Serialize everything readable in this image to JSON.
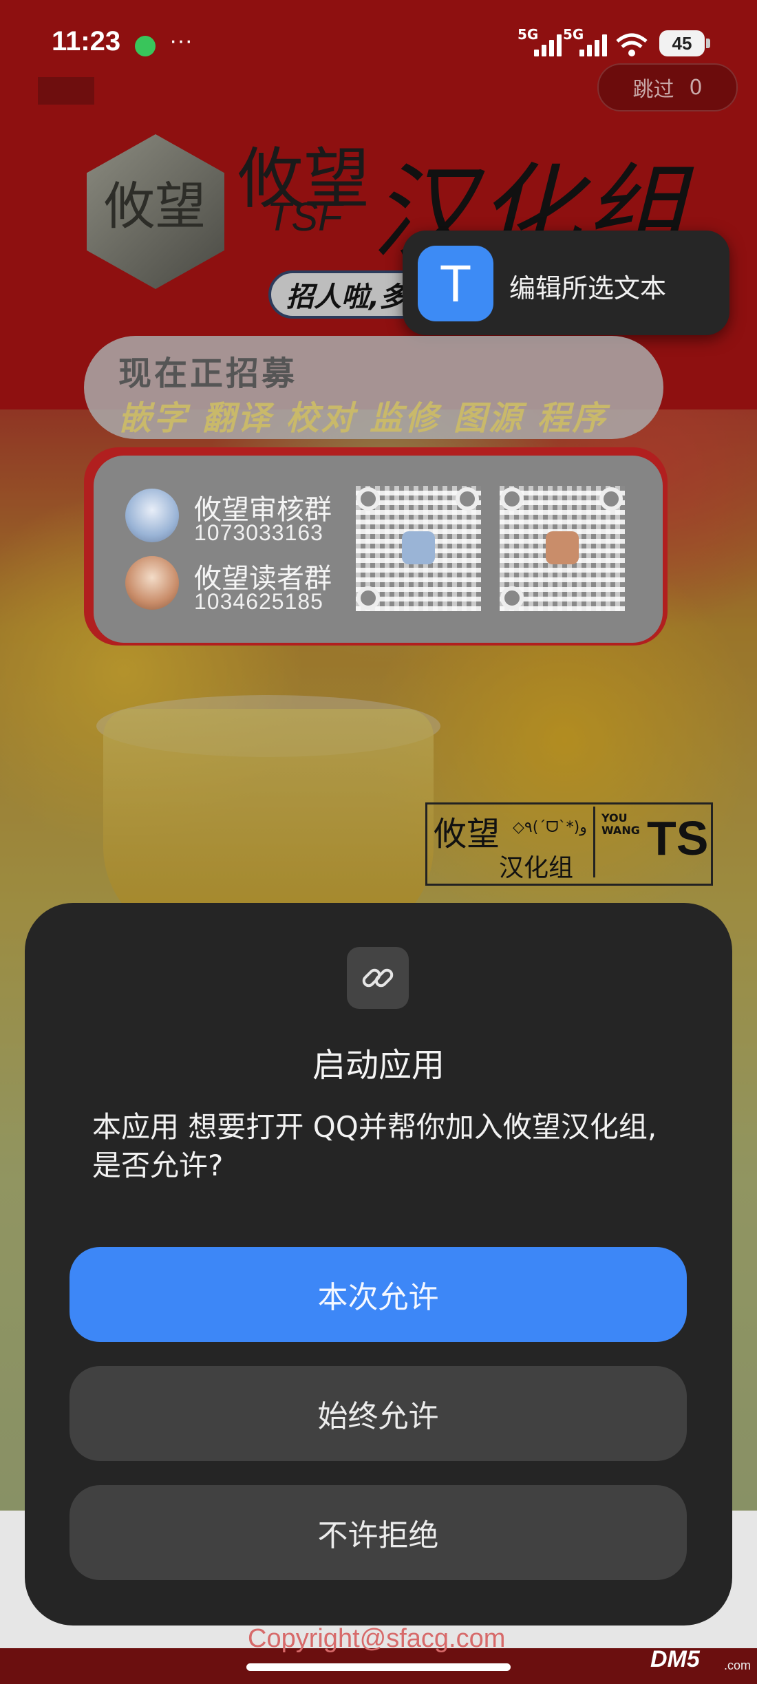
{
  "status_bar": {
    "time": "11:23",
    "dots": "···",
    "sim1": "5G",
    "sim2": "5G",
    "battery": "45"
  },
  "skip": {
    "label": "跳过",
    "count": "0"
  },
  "logo": {
    "emblem": "攸望",
    "title_a": "攸望",
    "tsf": "TSF",
    "title_b": "汉化组",
    "pill": "招人啦,多"
  },
  "context_popup": {
    "icon_letter": "T",
    "label": "编辑所选文本"
  },
  "banner": {
    "title": "现在正招募",
    "roles": "嵌字 翻译 校对 监修 图源 程序"
  },
  "groups": [
    {
      "name": "攸望审核群",
      "number": "1073033163"
    },
    {
      "name": "攸望读者群",
      "number": "1034625185"
    }
  ],
  "stamp": {
    "line1": "攸望",
    "emoticon": "◇٩(ˊᗜˋ*)و",
    "line2": "汉化组",
    "side": "YOU WANG",
    "ts": "TS"
  },
  "dialog": {
    "title": "启动应用",
    "message": "本应用 想要打开 QQ并帮你加入攸望汉化组,是否允许?",
    "allow_once": "本次允许",
    "allow_always": "始终允许",
    "deny": "不许拒绝"
  },
  "footer": {
    "copyright": "Copyright@sfacg.com"
  },
  "watermark": {
    "brand": "DM5",
    "suffix": ".com"
  },
  "colors": {
    "primary_button": "#3d87f7",
    "dialog_bg": "#252525",
    "banner_red": "#8e1010"
  }
}
